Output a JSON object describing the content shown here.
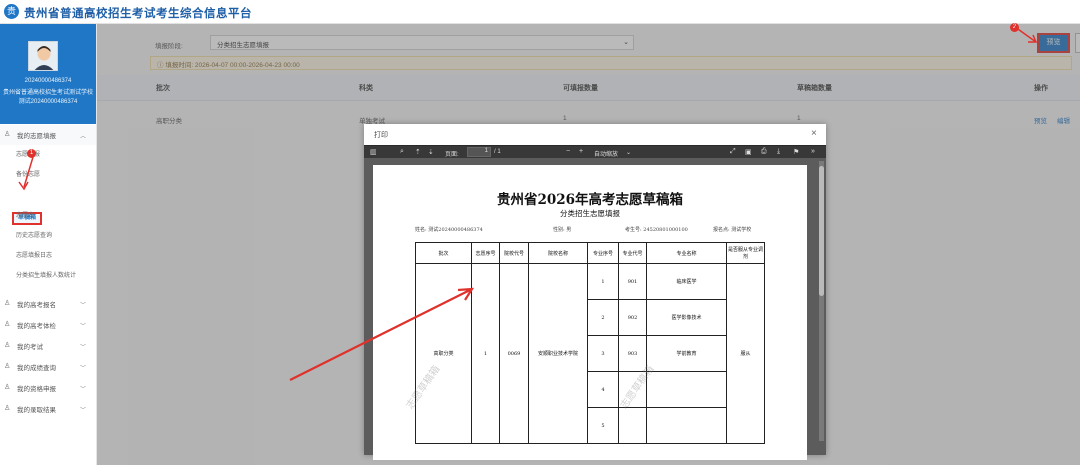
{
  "app": {
    "title": "贵州省普通高校招生考试考生综合信息平台",
    "logo_char": "贵"
  },
  "user": {
    "line1": "20240000486374",
    "line2": "贵州省普通高校招生考试测试学校",
    "line3": "测试20240000486374"
  },
  "nav": {
    "my_volunteer": "我的志愿填报",
    "sub_items": [
      "志愿填报",
      "备份志愿",
      "草稿箱",
      "志愿表",
      "历史志愿查询",
      "志愿填报日志",
      "分类招生填报人数统计"
    ],
    "sections": [
      "我的高考报名",
      "我的高考体检",
      "我的考试",
      "我的成绩查询",
      "我的资格申报",
      "我的录取结果"
    ],
    "badge1": "1"
  },
  "filter": {
    "label": "填报阶段:",
    "selected": "分类招生志愿填报"
  },
  "time_notice": "填报时间: 2026-04-07 00:00-2026-04-23 00:00",
  "preview_button": "预览",
  "badge2": "2",
  "table": {
    "headers": [
      "批次",
      "科类",
      "可填报数量",
      "草稿箱数量",
      "操作"
    ],
    "rows": [
      {
        "batch": "高职分类",
        "category": "单独考试",
        "fill_count": "1",
        "draft_count": "1",
        "op_preview": "预览",
        "op_edit": "编辑"
      }
    ]
  },
  "dialog": {
    "title": "打印",
    "close": "×",
    "toolbar": {
      "page_label": "页面:",
      "page_input": "1",
      "page_total": "/ 1",
      "zoom": "自动缩放",
      "zoom_minus": "−",
      "zoom_plus": "+"
    },
    "doc": {
      "title": "贵州省2026年高考志愿草稿箱",
      "subtitle": "分类招生志愿填报",
      "meta": {
        "name": "姓名: 测试20240000486374",
        "gender": "性别: 男",
        "exam_no": "考生号: 24520801000100",
        "reg_place": "报名点: 测试学校"
      },
      "col_headers": [
        "批次",
        "志愿序号",
        "院校代号",
        "院校名称",
        "专业序号",
        "专业代号",
        "专业名称",
        "是否服从专业调剂"
      ],
      "batch": "高职分类",
      "vol_no": "1",
      "school_code": "0069",
      "school_name": "安顺职业技术学院",
      "adjust": "服从",
      "majors": [
        {
          "seq": "1",
          "code": "901",
          "name": "临床医学"
        },
        {
          "seq": "2",
          "code": "902",
          "name": "医学影像技术"
        },
        {
          "seq": "3",
          "code": "903",
          "name": "学前教育"
        },
        {
          "seq": "4",
          "code": "",
          "name": ""
        },
        {
          "seq": "5",
          "code": "",
          "name": ""
        }
      ],
      "watermark": "志愿草稿箱"
    }
  },
  "colors": {
    "brand": "#1f77c6",
    "highlight": "#e0322d",
    "arrow": "#e0322d"
  }
}
